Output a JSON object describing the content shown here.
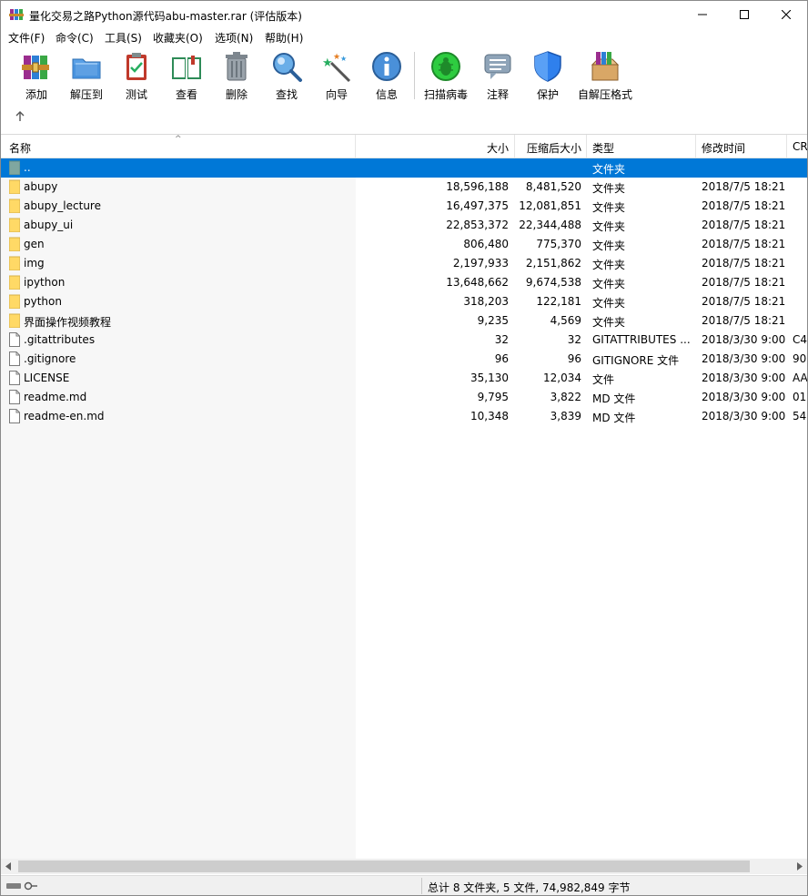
{
  "window": {
    "title": "量化交易之路Python源代码abu-master.rar (评估版本)",
    "minimize": "—",
    "maximize": "☐",
    "close": "✕"
  },
  "menu": [
    {
      "label": "文件(F)"
    },
    {
      "label": "命令(C)"
    },
    {
      "label": "工具(S)"
    },
    {
      "label": "收藏夹(O)"
    },
    {
      "label": "选项(N)"
    },
    {
      "label": "帮助(H)"
    }
  ],
  "toolbar": [
    {
      "label": "添加",
      "icon": "add-books-icon"
    },
    {
      "label": "解压到",
      "icon": "extract-folder-icon"
    },
    {
      "label": "测试",
      "icon": "test-clipboard-icon"
    },
    {
      "label": "查看",
      "icon": "view-book-icon"
    },
    {
      "label": "删除",
      "icon": "trash-icon"
    },
    {
      "label": "查找",
      "icon": "magnifier-icon"
    },
    {
      "label": "向导",
      "icon": "wizard-wand-icon"
    },
    {
      "label": "信息",
      "icon": "info-icon"
    },
    {
      "label": "扫描病毒",
      "icon": "virus-scan-icon"
    },
    {
      "label": "注释",
      "icon": "comment-icon"
    },
    {
      "label": "保护",
      "icon": "shield-icon"
    },
    {
      "label": "自解压格式",
      "icon": "sfx-box-icon"
    }
  ],
  "columns": {
    "name": "名称",
    "size": "大小",
    "packed": "压缩后大小",
    "type": "类型",
    "modified": "修改时间",
    "crc": "CR"
  },
  "files": [
    {
      "name": "..",
      "size": "",
      "packed": "",
      "type": "文件夹",
      "modified": "",
      "crc": "",
      "kind": "parent"
    },
    {
      "name": "abupy",
      "size": "18,596,188",
      "packed": "8,481,520",
      "type": "文件夹",
      "modified": "2018/7/5 18:21",
      "crc": "",
      "kind": "folder"
    },
    {
      "name": "abupy_lecture",
      "size": "16,497,375",
      "packed": "12,081,851",
      "type": "文件夹",
      "modified": "2018/7/5 18:21",
      "crc": "",
      "kind": "folder"
    },
    {
      "name": "abupy_ui",
      "size": "22,853,372",
      "packed": "22,344,488",
      "type": "文件夹",
      "modified": "2018/7/5 18:21",
      "crc": "",
      "kind": "folder"
    },
    {
      "name": "gen",
      "size": "806,480",
      "packed": "775,370",
      "type": "文件夹",
      "modified": "2018/7/5 18:21",
      "crc": "",
      "kind": "folder"
    },
    {
      "name": "img",
      "size": "2,197,933",
      "packed": "2,151,862",
      "type": "文件夹",
      "modified": "2018/7/5 18:21",
      "crc": "",
      "kind": "folder"
    },
    {
      "name": "ipython",
      "size": "13,648,662",
      "packed": "9,674,538",
      "type": "文件夹",
      "modified": "2018/7/5 18:21",
      "crc": "",
      "kind": "folder"
    },
    {
      "name": "python",
      "size": "318,203",
      "packed": "122,181",
      "type": "文件夹",
      "modified": "2018/7/5 18:21",
      "crc": "",
      "kind": "folder"
    },
    {
      "name": "界面操作视频教程",
      "size": "9,235",
      "packed": "4,569",
      "type": "文件夹",
      "modified": "2018/7/5 18:21",
      "crc": "",
      "kind": "folder"
    },
    {
      "name": ".gitattributes",
      "size": "32",
      "packed": "32",
      "type": "GITATTRIBUTES ...",
      "modified": "2018/3/30 9:00",
      "crc": "C4",
      "kind": "file"
    },
    {
      "name": ".gitignore",
      "size": "96",
      "packed": "96",
      "type": "GITIGNORE 文件",
      "modified": "2018/3/30 9:00",
      "crc": "90",
      "kind": "file"
    },
    {
      "name": "LICENSE",
      "size": "35,130",
      "packed": "12,034",
      "type": "文件",
      "modified": "2018/3/30 9:00",
      "crc": "AA",
      "kind": "file"
    },
    {
      "name": "readme.md",
      "size": "9,795",
      "packed": "3,822",
      "type": "MD 文件",
      "modified": "2018/3/30 9:00",
      "crc": "01",
      "kind": "file"
    },
    {
      "name": "readme-en.md",
      "size": "10,348",
      "packed": "3,839",
      "type": "MD 文件",
      "modified": "2018/3/30 9:00",
      "crc": "54",
      "kind": "file"
    }
  ],
  "status": {
    "summary": "总计 8 文件夹, 5 文件, 74,982,849 字节"
  },
  "colors": {
    "selection": "#0078d7",
    "folder": "#ffd966"
  }
}
